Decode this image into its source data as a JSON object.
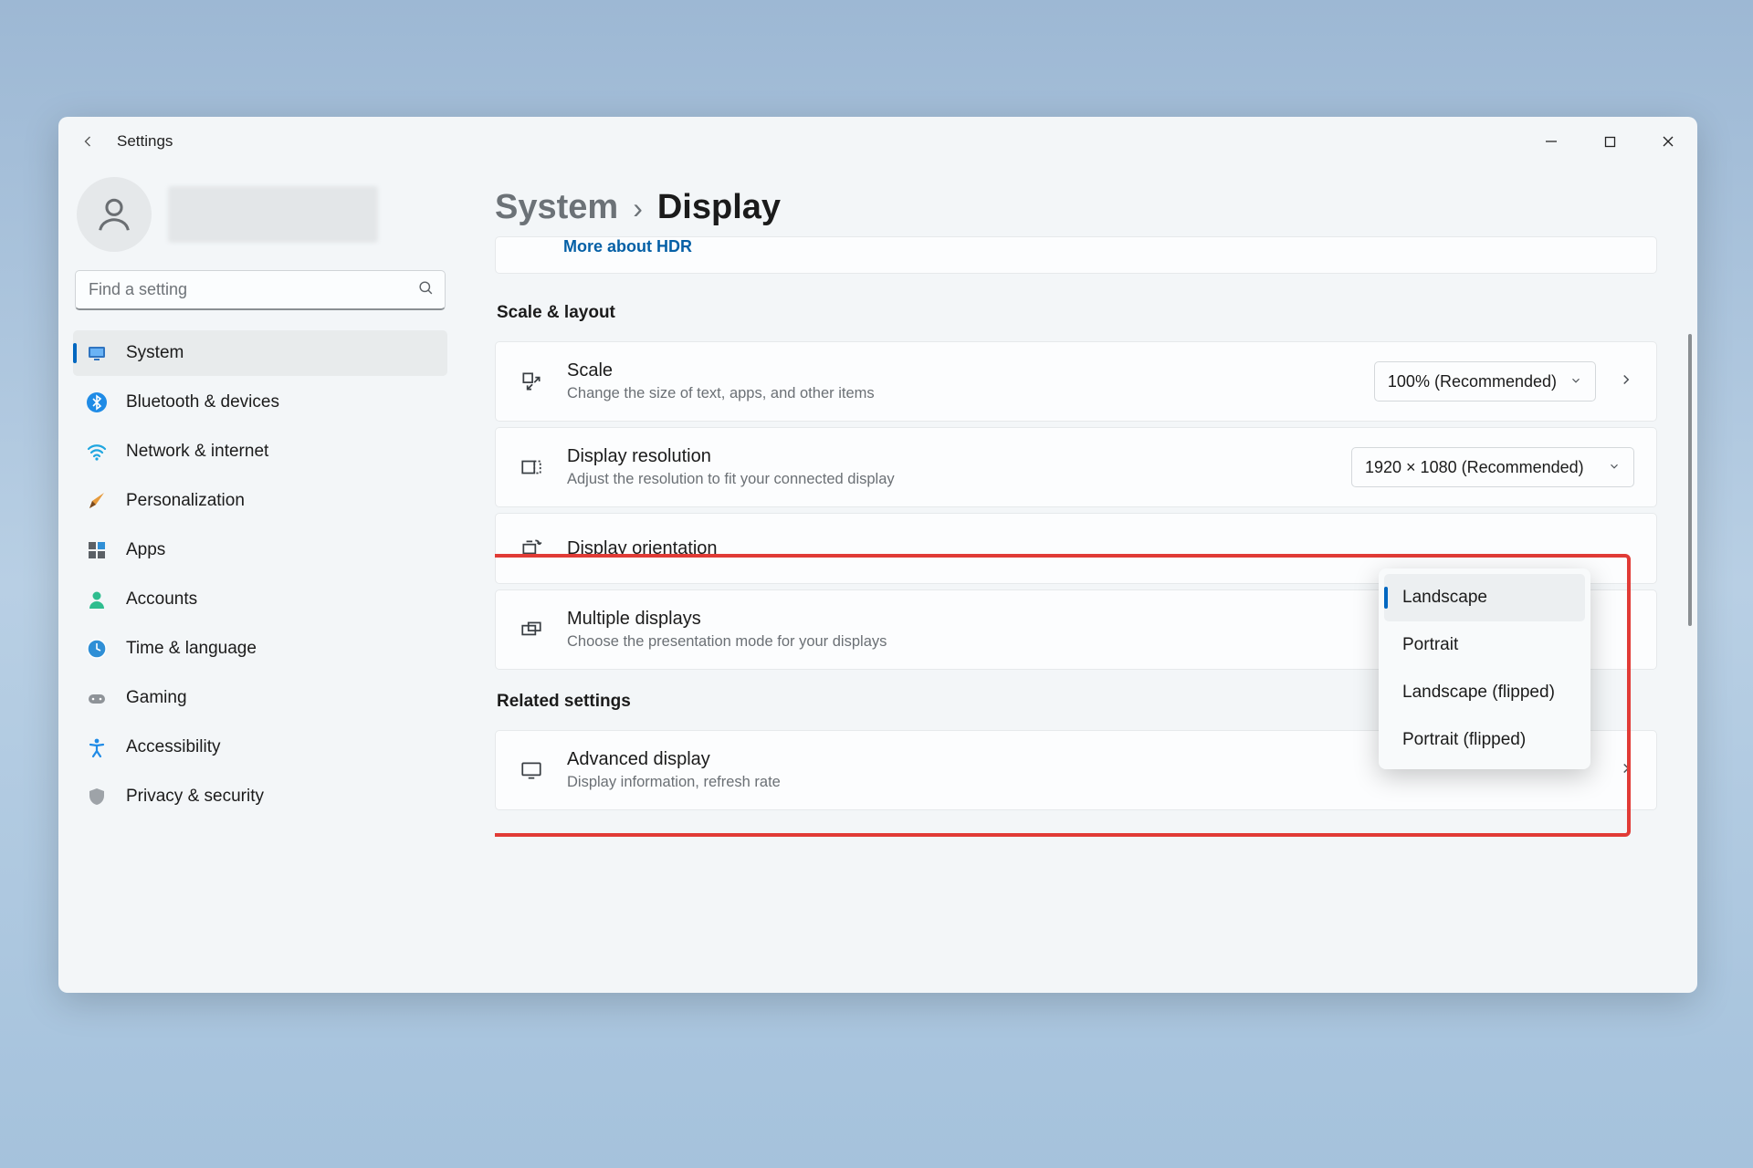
{
  "app": {
    "title": "Settings"
  },
  "search": {
    "placeholder": "Find a setting"
  },
  "nav": {
    "items": [
      {
        "label": "System"
      },
      {
        "label": "Bluetooth & devices"
      },
      {
        "label": "Network & internet"
      },
      {
        "label": "Personalization"
      },
      {
        "label": "Apps"
      },
      {
        "label": "Accounts"
      },
      {
        "label": "Time & language"
      },
      {
        "label": "Gaming"
      },
      {
        "label": "Accessibility"
      },
      {
        "label": "Privacy & security"
      }
    ]
  },
  "breadcrumb": {
    "parent": "System",
    "current": "Display"
  },
  "hdr": {
    "link": "More about HDR"
  },
  "sections": {
    "scale_layout": {
      "title": "Scale & layout",
      "scale": {
        "title": "Scale",
        "desc": "Change the size of text, apps, and other items",
        "value": "100% (Recommended)"
      },
      "resolution": {
        "title": "Display resolution",
        "desc": "Adjust the resolution to fit your connected display",
        "value": "1920 × 1080 (Recommended)"
      },
      "orientation": {
        "title": "Display orientation"
      },
      "multiple": {
        "title": "Multiple displays",
        "desc": "Choose the presentation mode for your displays"
      }
    },
    "related": {
      "title": "Related settings",
      "advanced": {
        "title": "Advanced display",
        "desc": "Display information, refresh rate"
      }
    }
  },
  "orientation_options": [
    "Landscape",
    "Portrait",
    "Landscape (flipped)",
    "Portrait (flipped)"
  ]
}
